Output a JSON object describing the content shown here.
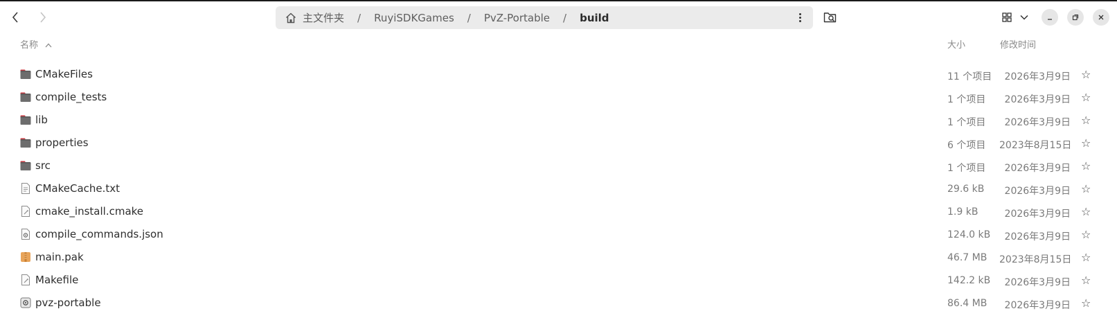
{
  "window": {
    "path": [
      {
        "label": "主文件夹",
        "icon": "home-icon"
      },
      {
        "label": "RuyiSDKGames"
      },
      {
        "label": "PvZ-Portable"
      },
      {
        "label": "build",
        "current": true
      }
    ],
    "separator": "/"
  },
  "columns": {
    "name": "名称",
    "size": "大小",
    "modified": "修改时间",
    "sort_column": "name",
    "sort_direction": "ascending"
  },
  "files": [
    {
      "name": "CMakeFiles",
      "type": "folder",
      "size": "11 个项目",
      "modified": "2026年3月9日"
    },
    {
      "name": "compile_tests",
      "type": "folder",
      "size": "1 个项目",
      "modified": "2026年3月9日"
    },
    {
      "name": "lib",
      "type": "folder",
      "size": "1 个项目",
      "modified": "2026年3月9日"
    },
    {
      "name": "properties",
      "type": "folder",
      "size": "6 个项目",
      "modified": "2023年8月15日"
    },
    {
      "name": "src",
      "type": "folder",
      "size": "1 个项目",
      "modified": "2026年3月9日"
    },
    {
      "name": "CMakeCache.txt",
      "type": "text",
      "size": "29.6 kB",
      "modified": "2026年3月9日"
    },
    {
      "name": "cmake_install.cmake",
      "type": "script",
      "size": "1.9 kB",
      "modified": "2026年3月9日"
    },
    {
      "name": "compile_commands.json",
      "type": "json",
      "size": "124.0 kB",
      "modified": "2026年3月9日"
    },
    {
      "name": "main.pak",
      "type": "archive",
      "size": "46.7 MB",
      "modified": "2023年8月15日"
    },
    {
      "name": "Makefile",
      "type": "script",
      "size": "142.2 kB",
      "modified": "2026年3月9日"
    },
    {
      "name": "pvz-portable",
      "type": "executable",
      "size": "86.4 MB",
      "modified": "2026年3月9日"
    }
  ],
  "colors": {
    "folder": "#5e5e5e",
    "folder_tab": "#c4353d",
    "archive": "#e8a45a",
    "pathbar_bg": "#ebebeb"
  }
}
